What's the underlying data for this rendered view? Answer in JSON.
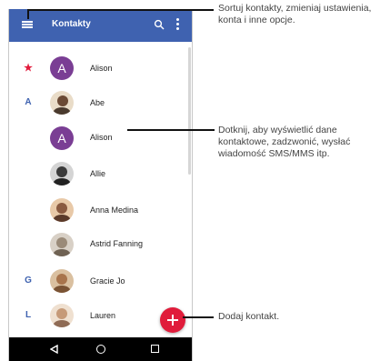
{
  "appbar": {
    "title": "Kontakty"
  },
  "contacts": [
    {
      "section": "★",
      "initial": "A",
      "name": "Alison",
      "avatar": "letter"
    },
    {
      "section": "A",
      "initial": "",
      "name": "Abe",
      "avatar": "photo",
      "color": "#6b4a35"
    },
    {
      "section": "",
      "initial": "A",
      "name": "Alison",
      "avatar": "letter"
    },
    {
      "section": "",
      "initial": "",
      "name": "Allie",
      "avatar": "photo",
      "color": "#3a3a3a"
    },
    {
      "section": "",
      "initial": "",
      "name": "Anna Medina",
      "avatar": "photo",
      "color": "#8a5a40"
    },
    {
      "section": "",
      "initial": "",
      "name": "Astrid Fanning",
      "avatar": "photo",
      "color": "#9a8a78"
    },
    {
      "section": "G",
      "initial": "",
      "name": "Gracie Jo",
      "avatar": "photo",
      "color": "#a8744c"
    },
    {
      "section": "L",
      "initial": "",
      "name": "Lauren",
      "avatar": "photo",
      "color": "#c69a78"
    }
  ],
  "callouts": {
    "sort": "Sortuj kontakty, zmieniaj ustawienia, konta i inne opcje.",
    "tap": "Dotknij, aby wyświetlić dane kontaktowe, zadzwonić, wysłać wiadomość SMS/MMS itp.",
    "add": "Dodaj kontakt."
  },
  "colors": {
    "accent": "#3f62b0",
    "fab": "#e01c3b",
    "star": "#e21b3c",
    "avatar_letter_bg": "#7a3e94"
  },
  "icons": {
    "menu": "menu-icon",
    "search": "search-icon",
    "more": "more-vert-icon",
    "add": "add-icon",
    "back": "back-icon",
    "home": "home-icon",
    "recent": "recent-apps-icon"
  }
}
